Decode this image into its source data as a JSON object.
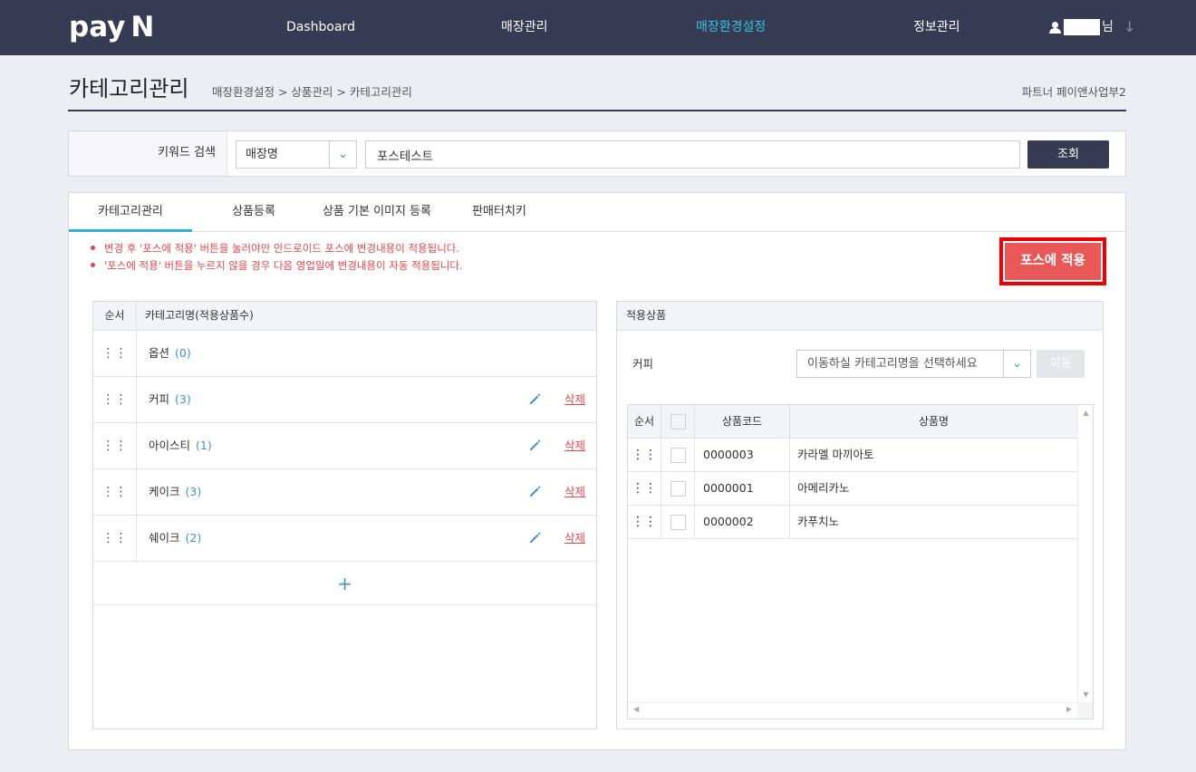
{
  "header": {
    "logo": "pay",
    "logo_mark": "N",
    "nav": [
      "Dashboard",
      "매장관리",
      "매장환경설정",
      "정보관리"
    ],
    "active_nav": "매장환경설정",
    "user_suffix": "님",
    "user_menu_icon": "↓"
  },
  "page": {
    "title": "카테고리관리",
    "breadcrumb": "매장환경설정 > 상품관리 > 카테고리관리",
    "partner": "파트너 페이앤사업부2"
  },
  "search": {
    "label": "키워드 검색",
    "field_selected": "매장명",
    "keyword": "포스테스트",
    "button": "조회"
  },
  "tabs": [
    "카테고리관리",
    "상품등록",
    "상품 기본 이미지 등록",
    "판매터치키"
  ],
  "notices": [
    "변경 후 '포스에 적용' 버튼을 눌러야만 안드로이드 포스에 변경내용이 적용됩니다.",
    "'포스에 적용' 버튼을 누르지 않을 경우 다음 영업일에 변경내용이 자동 적용됩니다."
  ],
  "apply_button": "포스에 적용",
  "category_table": {
    "headers": {
      "order": "순서",
      "name": "카테고리명(적용상품수)"
    },
    "rows": [
      {
        "name": "옵션",
        "count": "(0)",
        "delete": ""
      },
      {
        "name": "커피",
        "count": "(3)",
        "delete": "삭제"
      },
      {
        "name": "아이스티",
        "count": "(1)",
        "delete": "삭제"
      },
      {
        "name": "케이크",
        "count": "(3)",
        "delete": "삭제"
      },
      {
        "name": "쉐이크",
        "count": "(2)",
        "delete": "삭제"
      }
    ],
    "add_label": "+"
  },
  "applied_products": {
    "title": "적용상품",
    "current_category": "커피",
    "move_select_placeholder": "이동하실 카테고리명을 선택하세요",
    "move_button": "이동",
    "headers": {
      "order": "순서",
      "code": "상품코드",
      "name": "상품명"
    },
    "rows": [
      {
        "code": "0000003",
        "name": "카라멜 마끼아토"
      },
      {
        "code": "0000001",
        "name": "아메리카노"
      },
      {
        "code": "0000002",
        "name": "카푸치노"
      }
    ]
  },
  "colors": {
    "nav_bg": "#373a53",
    "accent": "#34c3dc",
    "danger": "#e0484b",
    "apply_bg": "#e95858"
  }
}
